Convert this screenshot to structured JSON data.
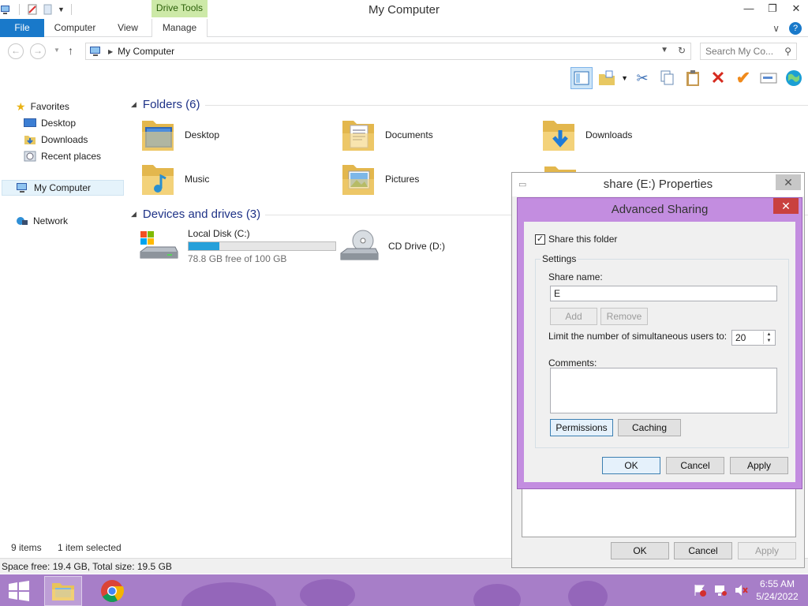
{
  "window": {
    "title": "My Computer",
    "contextual_tab": "Drive Tools",
    "controls": {
      "minimize": "—",
      "maximize": "❐",
      "close": "✕"
    }
  },
  "ribbon": {
    "tabs": [
      "File",
      "Computer",
      "View",
      "Manage"
    ],
    "right": {
      "chevron": "∨",
      "help": "?"
    }
  },
  "address_bar": {
    "path": "My Computer",
    "search_placeholder": "Search My Co..."
  },
  "sidebar": {
    "favorites": "Favorites",
    "items": [
      "Desktop",
      "Downloads",
      "Recent places"
    ],
    "my_computer": "My Computer",
    "network": "Network"
  },
  "main": {
    "folders_header": "Folders (6)",
    "folders": [
      "Desktop",
      "Documents",
      "Downloads",
      "Music",
      "Pictures"
    ],
    "drives_header": "Devices and drives (3)",
    "drives": [
      {
        "name": "Local Disk (C:)",
        "free": "78.8 GB free of 100 GB",
        "used_fraction": 0.212
      },
      {
        "name": "CD Drive (D:)"
      }
    ]
  },
  "status": {
    "items": "9 items",
    "selected": "1 item selected",
    "space": "Space free: 19.4 GB, Total size: 19.5 GB"
  },
  "properties_dialog": {
    "title": "share (E:) Properties",
    "ok": "OK",
    "cancel": "Cancel",
    "apply": "Apply"
  },
  "advanced_sharing": {
    "title": "Advanced Sharing",
    "share_checkbox": "Share this folder",
    "settings_legend": "Settings",
    "share_name_label": "Share name:",
    "share_name_value": "E",
    "add": "Add",
    "remove": "Remove",
    "limit_label": "Limit the number of simultaneous users to:",
    "limit_value": "20",
    "comments_label": "Comments:",
    "permissions": "Permissions",
    "caching": "Caching",
    "ok": "OK",
    "cancel": "Cancel",
    "apply": "Apply"
  },
  "taskbar": {
    "time": "6:55 AM",
    "date": "5/24/2022"
  },
  "colors": {
    "file_tab": "#1979ca",
    "drive_tools": "#cde9a8",
    "dialog_accent": "#c38de0",
    "close_red": "#c9413f",
    "taskbar": "#a77ec8",
    "drive_fill": "#26a0da"
  }
}
